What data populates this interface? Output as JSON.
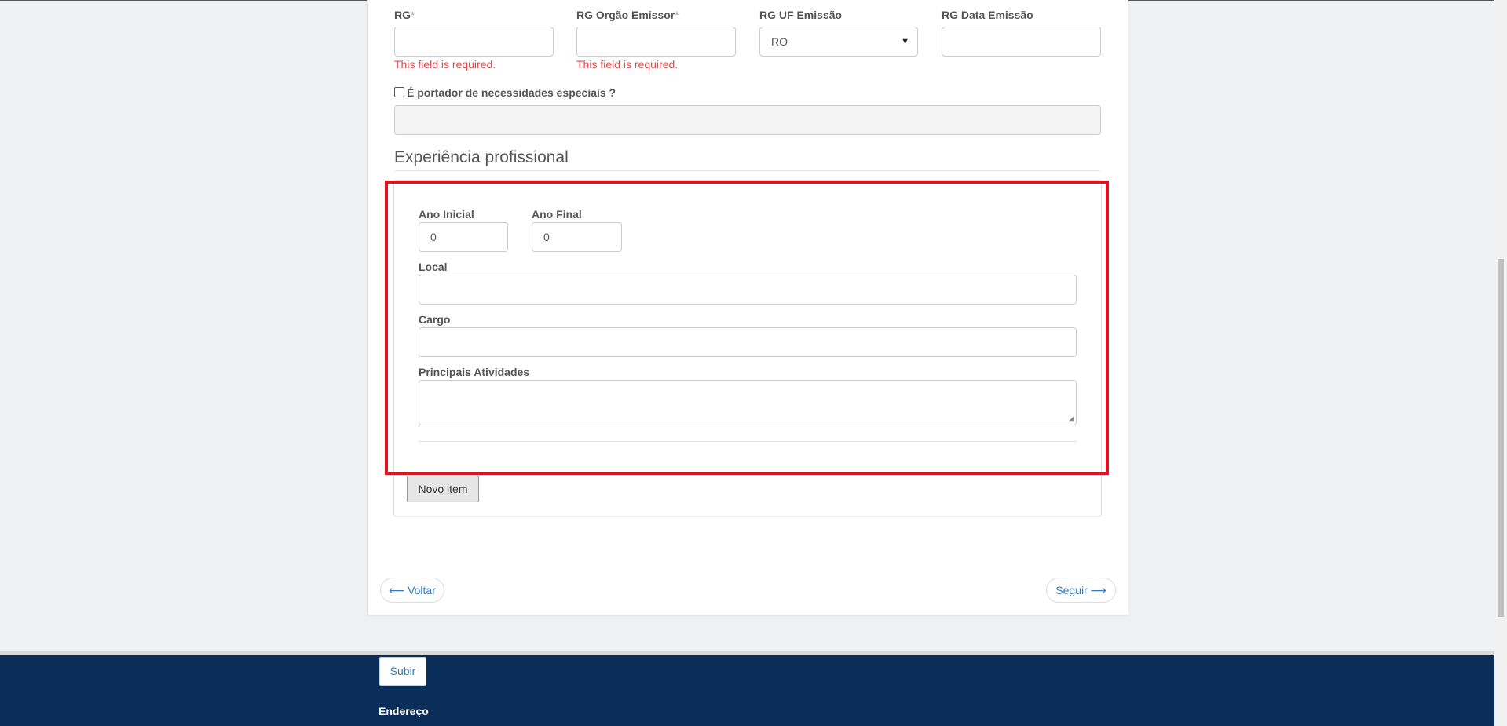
{
  "rg_section": {
    "rg_label": "RG",
    "rg_value": "",
    "rg_error": "This field is required.",
    "orgao_label": "RG Orgão Emissor",
    "orgao_value": "",
    "orgao_error": "This field is required.",
    "required_marker": "*",
    "uf_label": "RG UF Emissão",
    "uf_selected": "RO",
    "data_label": "RG Data Emissão",
    "data_value": ""
  },
  "special_needs": {
    "checkbox_label": "É portador de necessidades especiais ?",
    "checked": false,
    "details_value": ""
  },
  "experience": {
    "section_title": "Experiência profissional",
    "ano_inicial_label": "Ano Inicial",
    "ano_inicial_value": "0",
    "ano_final_label": "Ano Final",
    "ano_final_value": "0",
    "local_label": "Local",
    "local_value": "",
    "cargo_label": "Cargo",
    "cargo_value": "",
    "atividades_label": "Principais Atividades",
    "atividades_value": "",
    "new_item_label": "Novo item"
  },
  "navigation": {
    "back_label": "⟵ Voltar",
    "next_label": "Seguir ⟶"
  },
  "footer": {
    "subir_label": "Subir",
    "endereco_heading": "Endereço"
  },
  "colors": {
    "error": "#e34a4a",
    "highlight": "#e0141e",
    "link": "#337ab7",
    "footer_bg": "#0a2d5a"
  }
}
